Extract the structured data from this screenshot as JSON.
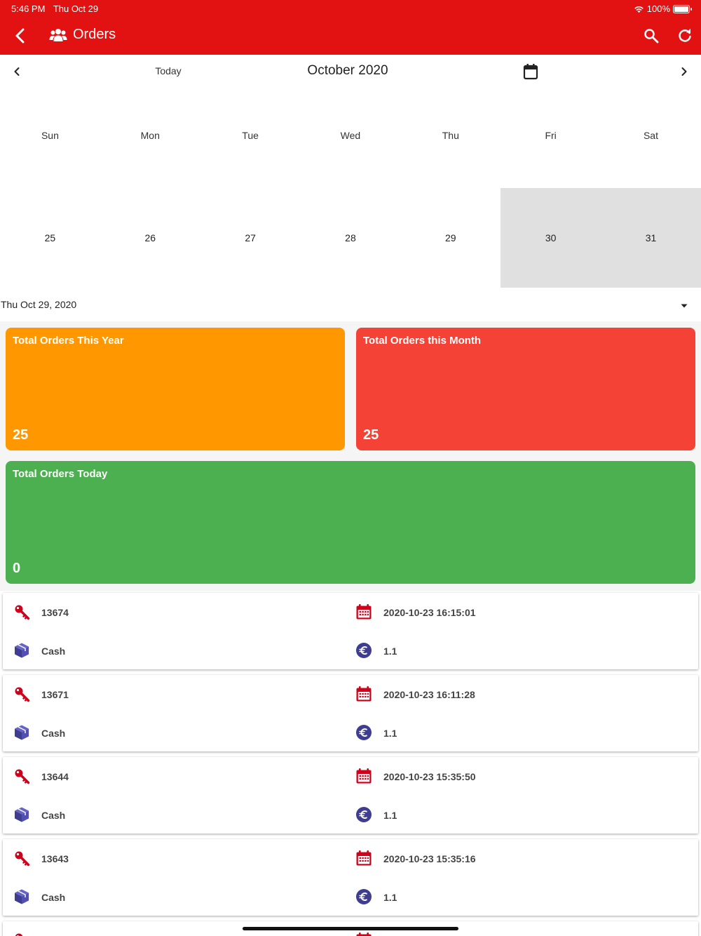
{
  "status": {
    "time": "5:46 PM",
    "date": "Thu Oct 29",
    "battery": "100%"
  },
  "app": {
    "title": "Orders"
  },
  "calendar": {
    "today_label": "Today",
    "month_label": "October 2020",
    "weekdays": [
      "Sun",
      "Mon",
      "Tue",
      "Wed",
      "Thu",
      "Fri",
      "Sat"
    ],
    "days": [
      "25",
      "26",
      "27",
      "28",
      "29",
      "30",
      "31"
    ],
    "selected_days": [
      "30",
      "31"
    ]
  },
  "selected_date": "Thu Oct 29, 2020",
  "stats": {
    "year": {
      "label": "Total Orders This Year",
      "value": "25"
    },
    "month": {
      "label": "Total Orders this Month",
      "value": "25"
    },
    "today": {
      "label": "Total Orders Today",
      "value": "0"
    }
  },
  "orders": [
    {
      "id": "13674",
      "datetime": "2020-10-23 16:15:01",
      "payment": "Cash",
      "amount": "1.1"
    },
    {
      "id": "13671",
      "datetime": "2020-10-23 16:11:28",
      "payment": "Cash",
      "amount": "1.1"
    },
    {
      "id": "13644",
      "datetime": "2020-10-23 15:35:50",
      "payment": "Cash",
      "amount": "1.1"
    },
    {
      "id": "13643",
      "datetime": "2020-10-23 15:35:16",
      "payment": "Cash",
      "amount": "1.1"
    }
  ],
  "colors": {
    "appbar": "#e31212",
    "year": "#ff9800",
    "month": "#f44336",
    "today": "#4caf50",
    "key_icon": "#d0021b",
    "box_icon": "#3f3d8f"
  },
  "icons": {
    "back": "back-arrow-icon",
    "title": "users-icon",
    "search": "search-icon",
    "refresh": "refresh-icon",
    "calendar": "calendar-icon",
    "key": "key-icon",
    "box": "box-icon",
    "euro": "euro-icon"
  }
}
